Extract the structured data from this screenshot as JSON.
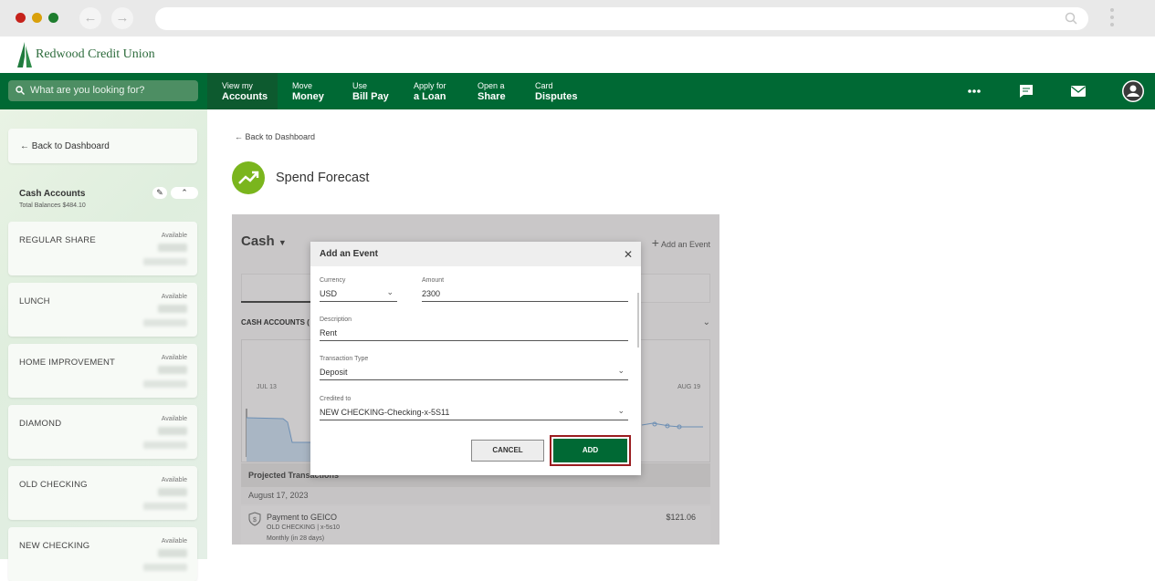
{
  "browser": {
    "url": ""
  },
  "brand": {
    "name": "Redwood Credit Union"
  },
  "search": {
    "placeholder": "What are you looking for?"
  },
  "nav": [
    {
      "line1": "View my",
      "line2": "Accounts"
    },
    {
      "line1": "Move",
      "line2": "Money"
    },
    {
      "line1": "Use",
      "line2": "Bill Pay"
    },
    {
      "line1": "Apply for",
      "line2": "a Loan"
    },
    {
      "line1": "Open a",
      "line2": "Share"
    },
    {
      "line1": "Card",
      "line2": "Disputes"
    }
  ],
  "top_icons": [
    "more-icon",
    "chat-icon",
    "mail-icon",
    "profile-icon"
  ],
  "sidebar": {
    "back_label": "Back to Dashboard",
    "cash_title": "Cash Accounts",
    "cash_total": "Total Balances $484.10",
    "accounts": [
      {
        "name": "REGULAR SHARE",
        "avail": "Available"
      },
      {
        "name": "LUNCH",
        "avail": "Available"
      },
      {
        "name": "HOME IMPROVEMENT",
        "avail": "Available"
      },
      {
        "name": "DIAMOND",
        "avail": "Available"
      },
      {
        "name": "OLD CHECKING",
        "avail": "Available"
      },
      {
        "name": "NEW CHECKING",
        "avail": "Available"
      }
    ]
  },
  "main": {
    "back_label": "Back to Dashboard",
    "title": "Spend Forecast",
    "panel": {
      "dropdown": "Cash",
      "add_event": "Add an Event",
      "section_label": "CASH ACCOUNTS (",
      "chart_label_left": "JUL 13",
      "chart_label_right": "AUG 19",
      "projected": "Projected Transactions",
      "date_header": "August 17, 2023",
      "txn_title": "Payment to GEICO",
      "txn_account": "OLD CHECKING | x-5s10",
      "txn_freq": "Monthly (in 28 days)",
      "txn_amount": "$121.06"
    }
  },
  "modal": {
    "title": "Add an Event",
    "currency_label": "Currency",
    "currency_value": "USD",
    "amount_label": "Amount",
    "amount_value": "2300",
    "description_label": "Description",
    "description_value": "Rent",
    "type_label": "Transaction Type",
    "type_value": "Deposit",
    "credited_label": "Credited to",
    "credited_value": "NEW CHECKING-Checking-x-5S11",
    "cancel": "CANCEL",
    "add": "ADD"
  },
  "colors": {
    "brand_green": "#006934",
    "highlight": "#9b1c20",
    "forecast_icon": "#7ab51d"
  }
}
